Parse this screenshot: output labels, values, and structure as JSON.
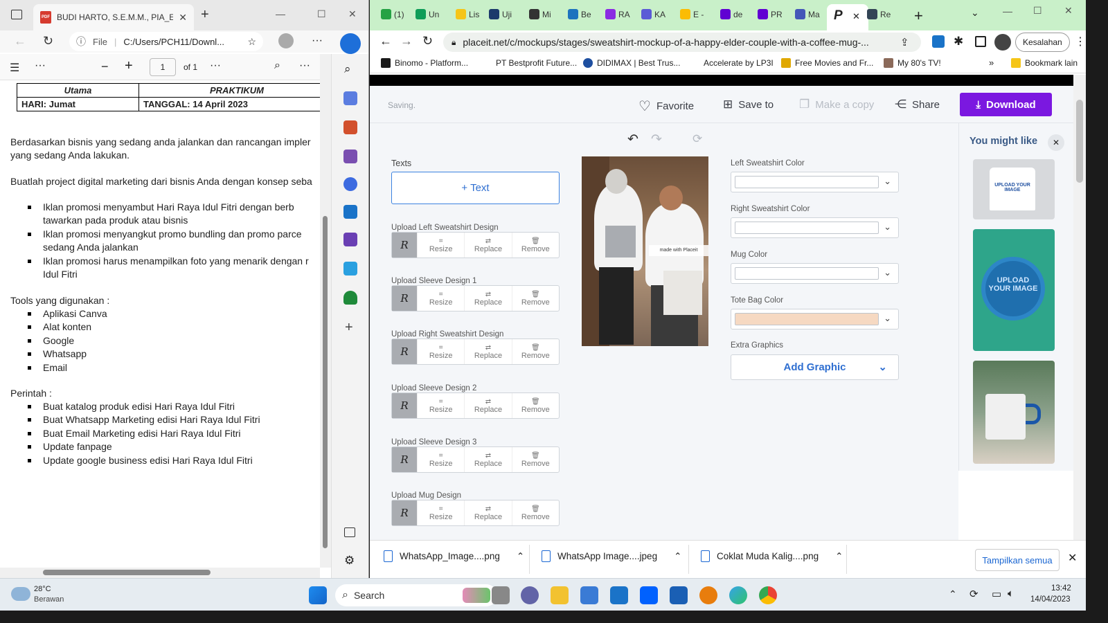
{
  "edge": {
    "tab_title": "BUDI HARTO, S.E.M.M., PIA_E-Co",
    "url_scheme": "File",
    "url_path": "C:/Users/PCH11/Downl...",
    "page_current": "1",
    "page_total": "of 1",
    "table": {
      "row1": [
        "Utama",
        "PRAKTIKUM"
      ],
      "row2": [
        "HARI: Jumat",
        "TANGGAL: 14 April 2023"
      ]
    },
    "para1_line1": "Berdasarkan bisnis yang sedang anda jalankan dan rancangan impler",
    "para1_line2": "yang sedang Anda lakukan.",
    "para2": "Buatlah project digital marketing dari bisnis Anda dengan konsep seba",
    "bullets1": [
      [
        "Iklan promosi menyambut Hari Raya Idul Fitri dengan berb",
        "tawarkan pada produk atau bisnis"
      ],
      [
        "Iklan promosi menyangkut promo bundling dan promo parce",
        "sedang Anda jalankan"
      ],
      [
        "Iklan promosi harus menampilkan foto yang menarik dengan r",
        "Idul Fitri"
      ]
    ],
    "tools_heading": "Tools yang digunakan :",
    "tools": [
      "Aplikasi Canva",
      "Alat konten",
      "Google",
      "Whatsapp",
      "Email"
    ],
    "perintah_heading": "Perintah :",
    "perintah": [
      "Buat katalog produk edisi Hari Raya Idul Fitri",
      "Buat Whatsapp Marketing edisi Hari Raya Idul Fitri",
      "Buat Email Marketing edisi Hari Raya Idul Fitri",
      "Update fanpage",
      "Update google business edisi Hari Raya Idul Fitri"
    ]
  },
  "chrome": {
    "tabs": [
      "(1)",
      "Un",
      "Lis",
      "Uji",
      "Mi",
      "Be",
      "RA",
      "KA",
      "E -",
      "de",
      "PR",
      "Ma",
      "Re"
    ],
    "tab_colors": [
      "#25a244",
      "#0f9d58",
      "#f5c518",
      "#1b3a6b",
      "#333333",
      "#1e73be",
      "#8a2be2",
      "#5b5bd6",
      "#fbbc04",
      "#6001d2",
      "#6001d2",
      "#4457b8",
      "#334455"
    ],
    "url": "placeit.net/c/mockups/stages/sweatshirt-mockup-of-a-happy-elder-couple-with-a-coffee-mug-...",
    "profile_label": "Kesalahan",
    "bookmarks": [
      "Binomo - Platform...",
      "PT Bestprofit Future...",
      "DIDIMAX | Best Trus...",
      "Accelerate by LP3I",
      "Free Movies and Fr...",
      "My 80's TV!"
    ],
    "bookmarks_other": "Bookmark lain"
  },
  "placeit": {
    "status": "Saving.",
    "favorite": "Favorite",
    "save_to": "Save to",
    "make_copy": "Make a copy",
    "share": "Share",
    "download": "Download",
    "texts_label": "Texts",
    "text_button": "+ Text",
    "uploads": [
      "Upload Left Sweatshirt Design",
      "Upload Sleeve Design 1",
      "Upload Right Sweatshirt Design",
      "Upload Sleeve Design 2",
      "Upload Sleeve Design 3",
      "Upload Mug Design"
    ],
    "resize": "Resize",
    "replace": "Replace",
    "remove": "Remove",
    "watermark": "made with Placeit",
    "colors": [
      {
        "label": "Left Sweatshirt Color",
        "value": "#ffffff"
      },
      {
        "label": "Right Sweatshirt Color",
        "value": "#ffffff"
      },
      {
        "label": "Mug Color",
        "value": "#ffffff"
      },
      {
        "label": "Tote Bag Color",
        "value": "#f6d9c2"
      }
    ],
    "extra_graphics": "Extra Graphics",
    "add_graphic": "Add Graphic",
    "you_might_like": "You might like",
    "thumb_text": "UPLOAD YOUR IMAGE"
  },
  "downloads": {
    "items": [
      "WhatsApp_Image....png",
      "WhatsApp Image....jpeg",
      "Coklat Muda Kalig....png"
    ],
    "show_all": "Tampilkan semua"
  },
  "taskbar": {
    "temp": "28°C",
    "weather": "Berawan",
    "search": "Search",
    "time": "13:42",
    "date": "14/04/2023"
  }
}
